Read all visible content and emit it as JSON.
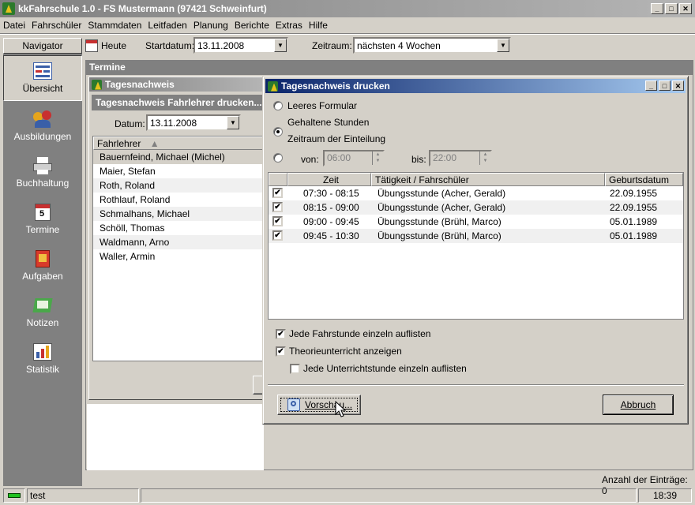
{
  "app": {
    "title": "kkFahrschule 1.0  -  FS Mustermann (97421 Schweinfurt)"
  },
  "menu": [
    "Datei",
    "Fahrschüler",
    "Stammdaten",
    "Leitfaden",
    "Planung",
    "Berichte",
    "Extras",
    "Hilfe"
  ],
  "toolbar": {
    "today_label": "Heute",
    "start_label": "Startdatum:",
    "start_value": "13.11.2008",
    "range_label": "Zeitraum:",
    "range_value": "nächsten 4 Wochen"
  },
  "navigator": {
    "title": "Navigator",
    "items": [
      {
        "label": "Übersicht",
        "icon": "overview-icon"
      },
      {
        "label": "Ausbildungen",
        "icon": "people-icon"
      },
      {
        "label": "Buchhaltung",
        "icon": "printer-icon"
      },
      {
        "label": "Termine",
        "icon": "calendar-icon"
      },
      {
        "label": "Aufgaben",
        "icon": "book-icon"
      },
      {
        "label": "Notizen",
        "icon": "note-icon"
      },
      {
        "label": "Statistik",
        "icon": "chart-icon"
      }
    ]
  },
  "section": {
    "title": "Termine"
  },
  "tagesnachweis": {
    "title": "Tagesnachweis",
    "subtitle": "Tagesnachweis Fahrlehrer drucken...",
    "date_label": "Datum:",
    "date_value": "13.11.2008",
    "column": "Fahrlehrer",
    "rows": [
      "Bauernfeind, Michael (Michel)",
      "Maier, Stefan",
      "Roth, Roland",
      "Rothlauf, Roland",
      "Schmalhans, Michael",
      "Schöll, Thomas",
      "Waldmann, Arno",
      "Waller, Armin"
    ]
  },
  "dialog": {
    "title": "Tagesnachweis drucken",
    "radio1": "Leeres Formular",
    "radio2": "Gehaltene Stunden",
    "radio3": "Zeitraum der Einteilung",
    "from_label": "von:",
    "from_value": "06:00",
    "to_label": "bis:",
    "to_value": "22:00",
    "columns": [
      "Zeit",
      "Tätigkeit / Fahrschüler",
      "Geburtsdatum"
    ],
    "rows": [
      {
        "time": "07:30 - 08:15",
        "activity": "Übungsstunde (Acher, Gerald)",
        "birth": "22.09.1955",
        "checked": "✔"
      },
      {
        "time": "08:15 - 09:00",
        "activity": "Übungsstunde (Acher, Gerald)",
        "birth": "22.09.1955",
        "checked": "✔"
      },
      {
        "time": "09:00 - 09:45",
        "activity": "Übungsstunde (Brühl, Marco)",
        "birth": "05.01.1989",
        "checked": "✔"
      },
      {
        "time": "09:45 - 10:30",
        "activity": "Übungsstunde (Brühl, Marco)",
        "birth": "05.01.1989",
        "checked": "✔"
      }
    ],
    "opt1": "Jede Fahrstunde einzeln auflisten",
    "opt1_mark": "✔",
    "opt2": "Theorieunterricht anzeigen",
    "opt2_mark": "✔",
    "opt3": "Jede Unterrichtstunde einzeln auflisten",
    "opt3_mark": "",
    "preview": "Vorschau...",
    "cancel": "Abbruch"
  },
  "footer": {
    "count": "Anzahl der Einträge: 0"
  },
  "statusbar": {
    "user": "test",
    "time": "18:39"
  }
}
